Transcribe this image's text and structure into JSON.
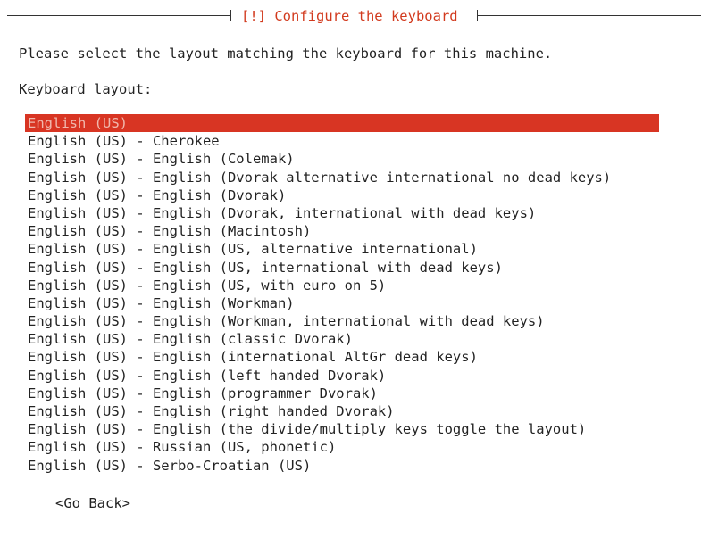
{
  "dialog": {
    "title": "[!] Configure the keyboard",
    "prompt": "Please select the layout matching the keyboard for this machine.",
    "field_label": "Keyboard layout:",
    "selected_index": 0,
    "layouts": [
      "English (US)",
      "English (US) - Cherokee",
      "English (US) - English (Colemak)",
      "English (US) - English (Dvorak alternative international no dead keys)",
      "English (US) - English (Dvorak)",
      "English (US) - English (Dvorak, international with dead keys)",
      "English (US) - English (Macintosh)",
      "English (US) - English (US, alternative international)",
      "English (US) - English (US, international with dead keys)",
      "English (US) - English (US, with euro on 5)",
      "English (US) - English (Workman)",
      "English (US) - English (Workman, international with dead keys)",
      "English (US) - English (classic Dvorak)",
      "English (US) - English (international AltGr dead keys)",
      "English (US) - English (left handed Dvorak)",
      "English (US) - English (programmer Dvorak)",
      "English (US) - English (right handed Dvorak)",
      "English (US) - English (the divide/multiply keys toggle the layout)",
      "English (US) - Russian (US, phonetic)",
      "English (US) - Serbo-Croatian (US)"
    ],
    "go_back_label": "<Go Back>"
  },
  "colors": {
    "title": "#d23a1e",
    "selection_bg": "#d83523",
    "selection_text": "#f0b8ad",
    "text": "#222222",
    "background": "#ffffff"
  }
}
